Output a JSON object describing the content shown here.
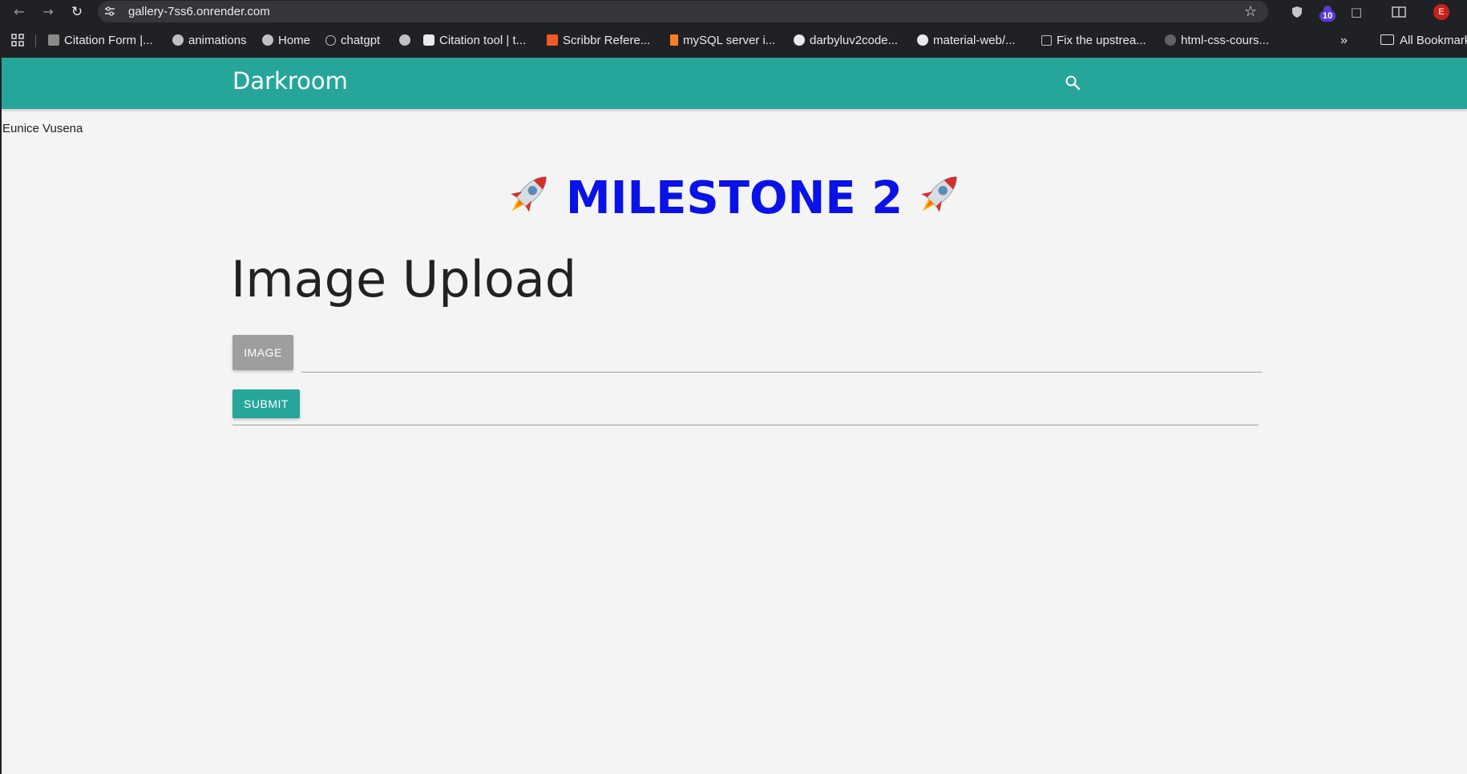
{
  "browser": {
    "url": "gallery-7ss6.onrender.com",
    "extension_badge": "10",
    "profile_initial": "E",
    "bookmarks": [
      {
        "label": "Citation Form |...",
        "icon": "citation-form-icon"
      },
      {
        "label": "animations",
        "icon": "globe-icon"
      },
      {
        "label": "Home",
        "icon": "globe-icon"
      },
      {
        "label": "chatgpt",
        "icon": "chatgpt-icon"
      },
      {
        "label": "",
        "icon": "globe-icon"
      },
      {
        "label": "Citation tool | t...",
        "icon": "citation-tool-icon"
      },
      {
        "label": "Scribbr Refere...",
        "icon": "scribbr-icon"
      },
      {
        "label": "mySQL server i...",
        "icon": "stackoverflow-icon"
      },
      {
        "label": "darbyluv2code...",
        "icon": "github-icon"
      },
      {
        "label": "material-web/...",
        "icon": "github-icon"
      },
      {
        "label": "Fix the upstrea...",
        "icon": "package-icon"
      },
      {
        "label": "html-css-cours...",
        "icon": "github-icon"
      }
    ],
    "overflow_label": "»",
    "all_bookmarks_label": "All Bookmarks"
  },
  "navbar": {
    "brand": "Darkroom",
    "color": "#26a69a"
  },
  "page": {
    "author": "Eunice Vusena",
    "milestone": "MILESTONE 2",
    "milestone_color": "#0a12e8",
    "title": "Image Upload",
    "image_button": "IMAGE",
    "file_path_value": "",
    "submit_button": "SUBMIT"
  }
}
